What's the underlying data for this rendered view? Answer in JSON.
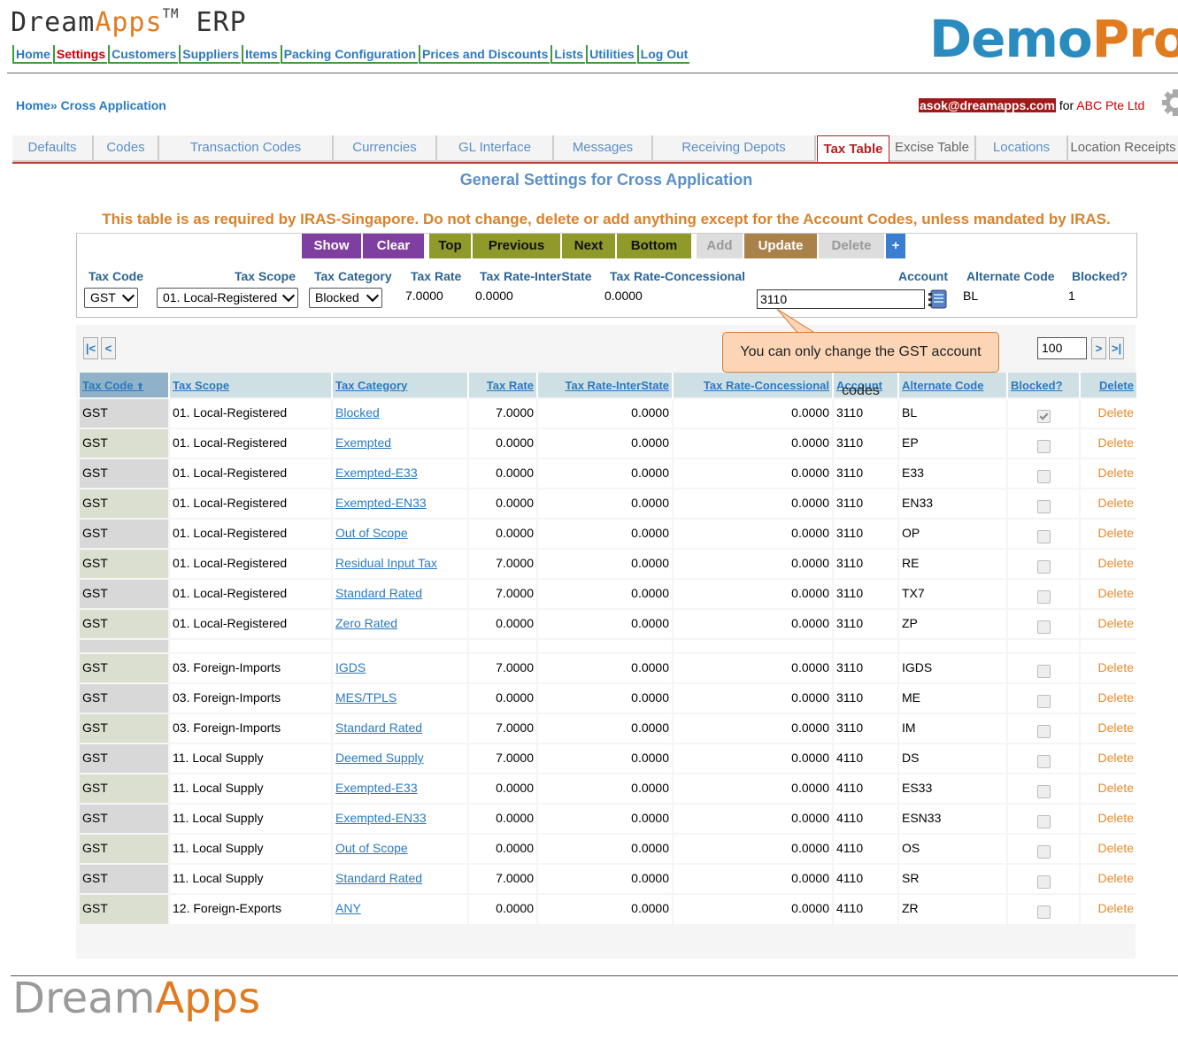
{
  "app": {
    "logo_dream": "Dream",
    "logo_apps": "Apps",
    "logo_tm": "TM",
    "logo_erp": " ERP"
  },
  "topnav": [
    "Home",
    "Settings",
    "Customers",
    "Suppliers",
    "Items",
    "Packing Configuration",
    "Prices and Discounts",
    "Lists",
    "Utilities",
    "Log Out"
  ],
  "brand": {
    "part1": "Demo",
    "part2": "Pro"
  },
  "breadcrumb": "Home» Cross Application",
  "user": {
    "email": "asok@dreamapps.com",
    "for": " for ",
    "company": "ABC Pte Ltd"
  },
  "tabs": [
    "Defaults",
    "Codes",
    "Transaction Codes",
    "Currencies",
    "GL Interface",
    "Messages",
    "Receiving Depots",
    "Tax Table",
    "Excise Table",
    "Locations",
    "Location Receipts"
  ],
  "page_title": "General Settings for Cross Application",
  "warning": "This table is as required by IRAS-Singapore. Do not change, delete or add anything except for the Account Codes, unless mandated by IRAS.",
  "buttons": {
    "show": "Show",
    "clear": "Clear",
    "top": "Top",
    "previous": "Previous",
    "next": "Next",
    "bottom": "Bottom",
    "add": "Add",
    "update": "Update",
    "delete": "Delete",
    "plus": "+"
  },
  "form": {
    "labels": {
      "tax_code": "Tax Code",
      "tax_scope": "Tax Scope",
      "tax_category": "Tax Category",
      "tax_rate": "Tax Rate",
      "tax_rate_interstate": "Tax Rate-InterState",
      "tax_rate_concessional": "Tax Rate-Concessional",
      "account": "Account",
      "alternate_code": "Alternate Code",
      "blocked": "Blocked?"
    },
    "tax_code": "GST",
    "tax_scope": "01. Local-Registered",
    "tax_category": "Blocked",
    "tax_rate": "7.0000",
    "tax_rate_interstate": "0.0000",
    "tax_rate_concessional": "0.0000",
    "account": "3110",
    "alternate_code": "BL",
    "blocked": "1"
  },
  "pager": {
    "first": "|<",
    "prev": "<",
    "next": ">",
    "last": ">|",
    "page_size": "100"
  },
  "callout": "You can only change the GST account codes",
  "columns": [
    "Tax Code",
    "Tax Scope",
    "Tax Category",
    "Tax Rate",
    "Tax Rate-InterState",
    "Tax Rate-Concessional",
    "Account",
    "Alternate Code",
    "Blocked?",
    "Delete"
  ],
  "rows": [
    {
      "code": "GST",
      "scope": "01. Local-Registered",
      "category": "Blocked",
      "rate": "7.0000",
      "inter": "0.0000",
      "conc": "0.0000",
      "account": "3110",
      "alt": "BL",
      "blocked": true,
      "del": "Delete"
    },
    {
      "code": "GST",
      "scope": "01. Local-Registered",
      "category": "Exempted",
      "rate": "0.0000",
      "inter": "0.0000",
      "conc": "0.0000",
      "account": "3110",
      "alt": "EP",
      "blocked": false,
      "del": "Delete"
    },
    {
      "code": "GST",
      "scope": "01. Local-Registered",
      "category": "Exempted-E33",
      "rate": "0.0000",
      "inter": "0.0000",
      "conc": "0.0000",
      "account": "3110",
      "alt": "E33",
      "blocked": false,
      "del": "Delete"
    },
    {
      "code": "GST",
      "scope": "01. Local-Registered",
      "category": "Exempted-EN33",
      "rate": "0.0000",
      "inter": "0.0000",
      "conc": "0.0000",
      "account": "3110",
      "alt": "EN33",
      "blocked": false,
      "del": "Delete"
    },
    {
      "code": "GST",
      "scope": "01. Local-Registered",
      "category": "Out of Scope",
      "rate": "0.0000",
      "inter": "0.0000",
      "conc": "0.0000",
      "account": "3110",
      "alt": "OP",
      "blocked": false,
      "del": "Delete"
    },
    {
      "code": "GST",
      "scope": "01. Local-Registered",
      "category": "Residual Input Tax",
      "rate": "7.0000",
      "inter": "0.0000",
      "conc": "0.0000",
      "account": "3110",
      "alt": "RE",
      "blocked": false,
      "del": "Delete"
    },
    {
      "code": "GST",
      "scope": "01. Local-Registered",
      "category": "Standard Rated",
      "rate": "7.0000",
      "inter": "0.0000",
      "conc": "0.0000",
      "account": "3110",
      "alt": "TX7",
      "blocked": false,
      "del": "Delete"
    },
    {
      "code": "GST",
      "scope": "01. Local-Registered",
      "category": "Zero Rated",
      "rate": "0.0000",
      "inter": "0.0000",
      "conc": "0.0000",
      "account": "3110",
      "alt": "ZP",
      "blocked": false,
      "del": "Delete"
    },
    {
      "partial": true
    },
    {
      "code": "GST",
      "scope": "03. Foreign-Imports",
      "category": "IGDS",
      "rate": "7.0000",
      "inter": "0.0000",
      "conc": "0.0000",
      "account": "3110",
      "alt": "IGDS",
      "blocked": false,
      "del": "Delete"
    },
    {
      "code": "GST",
      "scope": "03. Foreign-Imports",
      "category": "MES/TPLS",
      "rate": "0.0000",
      "inter": "0.0000",
      "conc": "0.0000",
      "account": "3110",
      "alt": "ME",
      "blocked": false,
      "del": "Delete"
    },
    {
      "code": "GST",
      "scope": "03. Foreign-Imports",
      "category": "Standard Rated",
      "rate": "7.0000",
      "inter": "0.0000",
      "conc": "0.0000",
      "account": "3110",
      "alt": "IM",
      "blocked": false,
      "del": "Delete"
    },
    {
      "code": "GST",
      "scope": "11. Local Supply",
      "category": "Deemed Supply",
      "rate": "7.0000",
      "inter": "0.0000",
      "conc": "0.0000",
      "account": "4110",
      "alt": "DS",
      "blocked": false,
      "del": "Delete"
    },
    {
      "code": "GST",
      "scope": "11. Local Supply",
      "category": "Exempted-E33",
      "rate": "0.0000",
      "inter": "0.0000",
      "conc": "0.0000",
      "account": "4110",
      "alt": "ES33",
      "blocked": false,
      "del": "Delete"
    },
    {
      "code": "GST",
      "scope": "11. Local Supply",
      "category": "Exempted-EN33",
      "rate": "0.0000",
      "inter": "0.0000",
      "conc": "0.0000",
      "account": "4110",
      "alt": "ESN33",
      "blocked": false,
      "del": "Delete"
    },
    {
      "code": "GST",
      "scope": "11. Local Supply",
      "category": "Out of Scope",
      "rate": "0.0000",
      "inter": "0.0000",
      "conc": "0.0000",
      "account": "4110",
      "alt": "OS",
      "blocked": false,
      "del": "Delete"
    },
    {
      "code": "GST",
      "scope": "11. Local Supply",
      "category": "Standard Rated",
      "rate": "7.0000",
      "inter": "0.0000",
      "conc": "0.0000",
      "account": "4110",
      "alt": "SR",
      "blocked": false,
      "del": "Delete"
    },
    {
      "code": "GST",
      "scope": "12. Foreign-Exports",
      "category": "ANY",
      "rate": "0.0000",
      "inter": "0.0000",
      "conc": "0.0000",
      "account": "4110",
      "alt": "ZR",
      "blocked": false,
      "del": "Delete"
    }
  ],
  "footer": {
    "dream": "Dream",
    "apps": "Apps"
  },
  "colors": {
    "accent_blue": "#2a7ac0",
    "brand_orange": "#e07b1f",
    "warning_orange": "#d9822b",
    "active_tab_red": "#b22222"
  }
}
